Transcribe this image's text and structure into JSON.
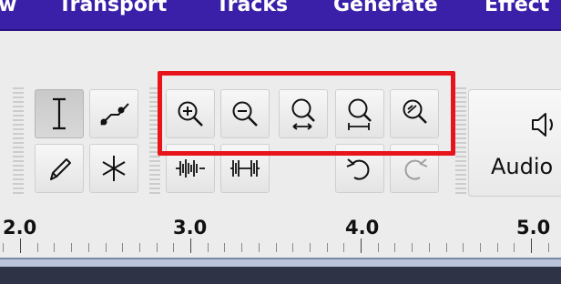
{
  "menubar": {
    "items": [
      "w",
      "Transport",
      "Tracks",
      "Generate",
      "Effect"
    ]
  },
  "tools": [
    {
      "name": "selection-tool",
      "icon": "i-beam-icon",
      "active": true
    },
    {
      "name": "envelope-tool",
      "icon": "envelope-icon",
      "active": false
    },
    {
      "name": "draw-tool",
      "icon": "pencil-icon",
      "active": false
    },
    {
      "name": "multi-tool",
      "icon": "asterisk-icon",
      "active": false
    }
  ],
  "zoom_toolbar": [
    {
      "name": "zoom-in",
      "icon": "zoom-in-icon"
    },
    {
      "name": "zoom-out",
      "icon": "zoom-out-icon"
    },
    {
      "name": "fit-selection",
      "icon": "fit-selection-icon"
    },
    {
      "name": "fit-project",
      "icon": "fit-project-icon"
    },
    {
      "name": "zoom-toggle",
      "icon": "zoom-toggle-icon"
    }
  ],
  "edit_toolbar": [
    {
      "name": "trim-audio",
      "icon": "trim-icon"
    },
    {
      "name": "silence-audio",
      "icon": "silence-icon"
    },
    {
      "name": "undo",
      "icon": "undo-icon",
      "enabled": true
    },
    {
      "name": "redo",
      "icon": "redo-icon",
      "enabled": false
    }
  ],
  "audio_setup": {
    "label": "Audio",
    "icon": "speaker-icon"
  },
  "highlight_color": "#e8141b",
  "ruler": {
    "labels": [
      "2.0",
      "3.0",
      "4.0",
      "5.0"
    ]
  }
}
